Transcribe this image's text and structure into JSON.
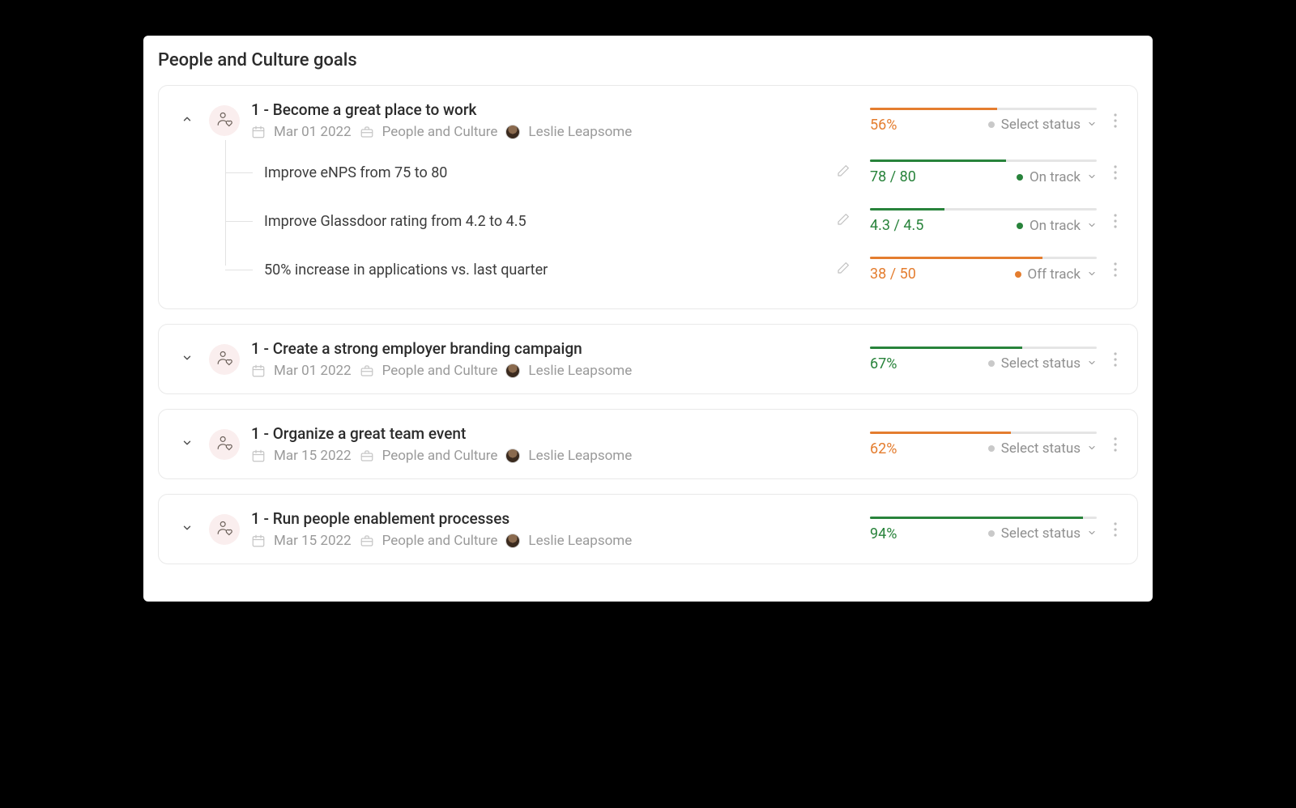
{
  "pageTitle": "People and Culture goals",
  "selectStatusLabel": "Select status",
  "goals": [
    {
      "title": "1 - Become a great place to work",
      "expanded": true,
      "date": "Mar 01 2022",
      "team": "People and Culture",
      "owner": "Leslie Leapsome",
      "progressText": "56%",
      "progressPercent": 56,
      "progressColor": "orange",
      "status": {
        "label": "Select status",
        "dot": "grey"
      },
      "krs": [
        {
          "title": "Improve eNPS from 75 to 80",
          "valueText": "78 / 80",
          "percent": 60,
          "color": "green",
          "status": {
            "label": "On track",
            "dot": "green"
          }
        },
        {
          "title": "Improve Glassdoor rating from 4.2 to 4.5",
          "valueText": "4.3 / 4.5",
          "percent": 33,
          "color": "green",
          "status": {
            "label": "On track",
            "dot": "green"
          }
        },
        {
          "title": "50% increase in applications vs. last quarter",
          "valueText": "38 / 50",
          "percent": 76,
          "color": "orange",
          "status": {
            "label": "Off track",
            "dot": "orange"
          }
        }
      ]
    },
    {
      "title": "1 - Create a strong employer branding campaign",
      "expanded": false,
      "date": "Mar 01 2022",
      "team": "People and Culture",
      "owner": "Leslie Leapsome",
      "progressText": "67%",
      "progressPercent": 67,
      "progressColor": "green",
      "status": {
        "label": "Select status",
        "dot": "grey"
      },
      "krs": []
    },
    {
      "title": "1 - Organize a great team event",
      "expanded": false,
      "date": "Mar 15 2022",
      "team": "People and Culture",
      "owner": "Leslie Leapsome",
      "progressText": "62%",
      "progressPercent": 62,
      "progressColor": "orange",
      "status": {
        "label": "Select status",
        "dot": "grey"
      },
      "krs": []
    },
    {
      "title": "1 - Run people enablement processes",
      "expanded": false,
      "date": "Mar 15 2022",
      "team": "People and Culture",
      "owner": "Leslie Leapsome",
      "progressText": "94%",
      "progressPercent": 94,
      "progressColor": "green",
      "status": {
        "label": "Select status",
        "dot": "grey"
      },
      "krs": []
    }
  ]
}
